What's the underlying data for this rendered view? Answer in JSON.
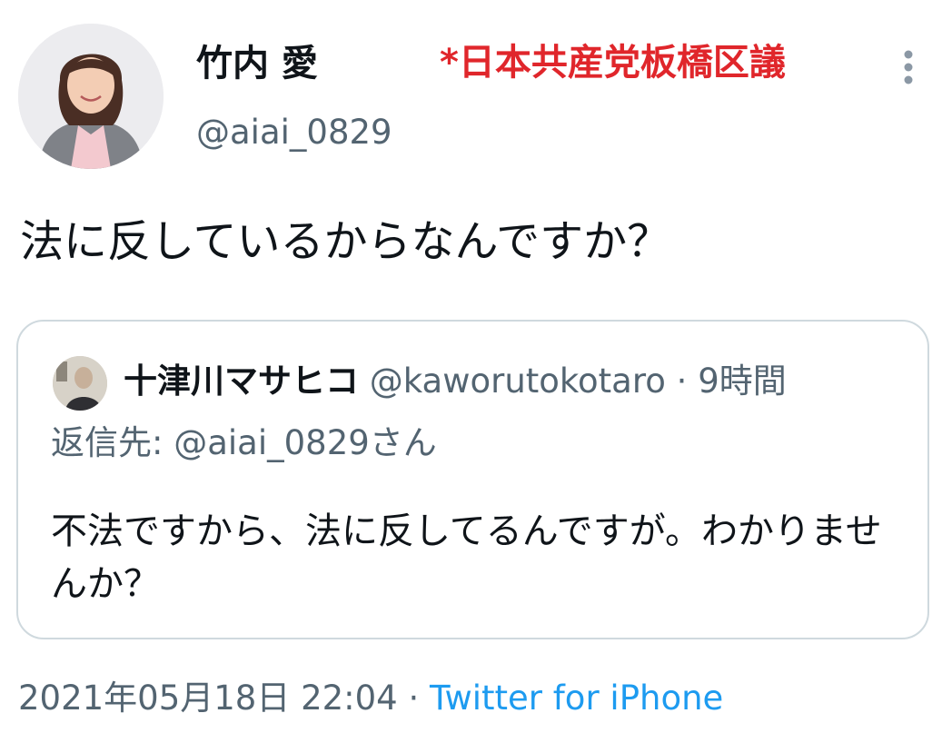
{
  "tweet": {
    "author": {
      "display_name": "竹内 愛",
      "handle": "@aiai_0829",
      "avatar": "profile-photo"
    },
    "overlay_note": {
      "text": "*日本共産党板橋区議",
      "color": "#e0262b"
    },
    "more_icon": "vertical-ellipsis-icon",
    "text": "法に反しているからなんですか？",
    "quoted": {
      "display_name": "十津川マサヒコ",
      "handle": "@kaworutokotaro",
      "separator": "·",
      "time": "9時間",
      "avatar": "profile-photo",
      "reply_to": "返信先: @aiai_0829さん",
      "text": "不法ですから、法に反してるんですが。わかりませんか？"
    },
    "footer": {
      "datetime": "2021年05月18日 22:04",
      "separator": "·",
      "source": "Twitter for iPhone"
    }
  },
  "colors": {
    "text": "#0f1419",
    "secondary": "#536471",
    "link": "#1d9bf0",
    "border": "#cfd9de"
  }
}
